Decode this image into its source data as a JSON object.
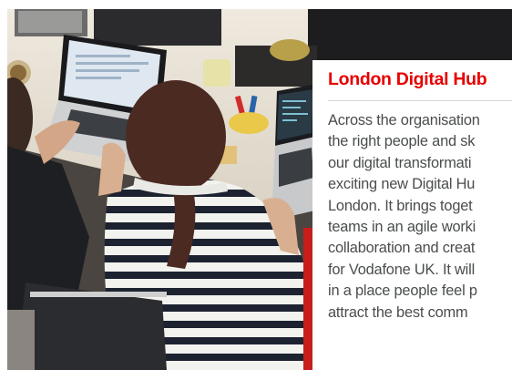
{
  "card": {
    "title": "London Digital Hub",
    "body_lines": [
      "Across the organisation",
      "the right people and sk",
      "our digital transformati",
      "exciting new Digital Hu",
      "London. It brings toget",
      "teams in an agile worki",
      "collaboration and creat",
      "for Vodafone UK. It will",
      "in a place people feel p",
      "attract the best comm"
    ]
  },
  "colors": {
    "accent": "#e60000",
    "body_text": "#4a4d4e",
    "rule": "#d6d6d6"
  }
}
